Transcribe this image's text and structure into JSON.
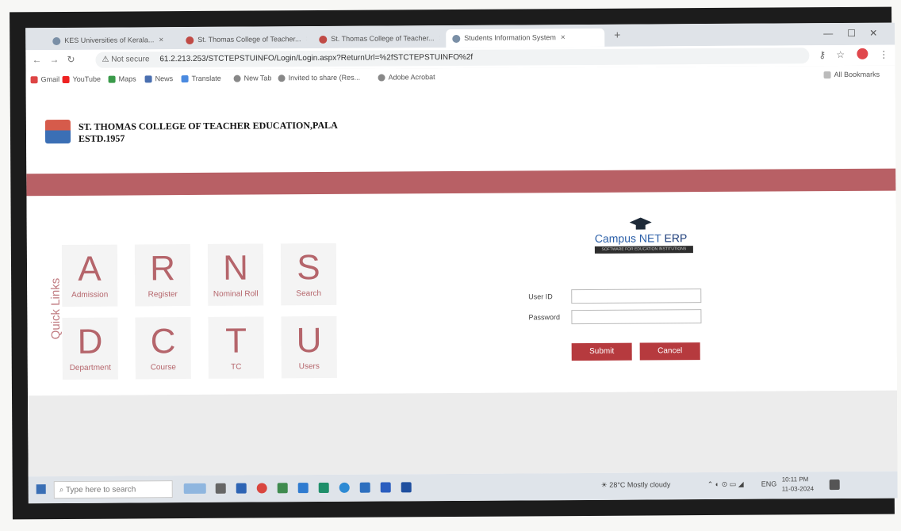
{
  "browser": {
    "tabs": [
      {
        "label": "KES Universities of Kerala..."
      },
      {
        "label": "St. Thomas College of Teacher..."
      },
      {
        "label": "St. Thomas College of Teacher..."
      },
      {
        "label": "Students Information System"
      }
    ],
    "url_warning": "Not secure",
    "url": "61.2.213.253/STCTEPSTUINFO/Login/Login.aspx?ReturnUrl=%2fSTCTEPSTUINFO%2f",
    "bookmarks": [
      "Gmail",
      "YouTube",
      "Maps",
      "News",
      "Translate",
      "New Tab",
      "Invited to share (Res...",
      "Adobe Acrobat"
    ],
    "all_bookmarks": "All Bookmarks"
  },
  "page": {
    "college_name": "ST. THOMAS COLLEGE OF TEACHER EDUCATION,PALA",
    "estd": "ESTD.1957",
    "quick_links_label": "Quick Links",
    "tiles": [
      {
        "letter": "A",
        "label": "Admission"
      },
      {
        "letter": "R",
        "label": "Register"
      },
      {
        "letter": "N",
        "label": "Nominal Roll"
      },
      {
        "letter": "S",
        "label": "Search"
      },
      {
        "letter": "D",
        "label": "Department"
      },
      {
        "letter": "C",
        "label": "Course"
      },
      {
        "letter": "T",
        "label": "TC"
      },
      {
        "letter": "U",
        "label": "Users"
      }
    ],
    "erp_brand_main": "Campus NET",
    "erp_brand_suffix": "ERP",
    "erp_tagline": "SOFTWARE FOR EDUCATION INSTITUTIONS",
    "user_id_label": "User ID",
    "password_label": "Password",
    "user_id_value": "",
    "password_value": "",
    "submit_label": "Submit",
    "cancel_label": "Cancel",
    "accent_color": "#b63a3e"
  },
  "taskbar": {
    "search_placeholder": "Type here to search",
    "weather": "28°C  Mostly cloudy",
    "lang": "ENG",
    "time": "10:11 PM",
    "date": "11-03-2024"
  }
}
